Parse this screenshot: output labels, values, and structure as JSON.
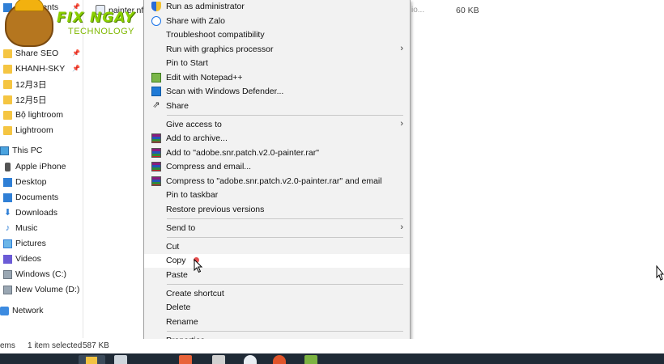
{
  "nav": {
    "items": [
      {
        "label": "Documents",
        "icon": "documents-icon",
        "pinned": true
      },
      {
        "label": "Share SEO",
        "icon": "folder-icon",
        "pinned": true
      },
      {
        "label": "KHANH-SKY",
        "icon": "folder-icon",
        "pinned": true
      },
      {
        "label": "12月3日",
        "icon": "folder-icon",
        "pinned": false
      },
      {
        "label": "12月5日",
        "icon": "folder-icon",
        "pinned": false
      },
      {
        "label": "Bộ lightroom",
        "icon": "folder-icon",
        "pinned": false
      },
      {
        "label": "Lightroom",
        "icon": "folder-icon",
        "pinned": false
      },
      {
        "label": "This PC",
        "icon": "computer-icon",
        "pinned": false
      },
      {
        "label": "Apple iPhone",
        "icon": "phone-icon",
        "pinned": false
      },
      {
        "label": "Desktop",
        "icon": "desktop-icon",
        "pinned": false
      },
      {
        "label": "Documents",
        "icon": "documents-icon",
        "pinned": false
      },
      {
        "label": "Downloads",
        "icon": "downloads-icon",
        "pinned": false
      },
      {
        "label": "Music",
        "icon": "music-icon",
        "pinned": false
      },
      {
        "label": "Pictures",
        "icon": "pictures-icon",
        "pinned": false
      },
      {
        "label": "Videos",
        "icon": "videos-icon",
        "pinned": false
      },
      {
        "label": "Windows (C:)",
        "icon": "drive-icon",
        "pinned": false
      },
      {
        "label": "New Volume (D:)",
        "icon": "drive-icon",
        "pinned": false
      },
      {
        "label": "Network",
        "icon": "network-icon",
        "pinned": false
      }
    ]
  },
  "logo": {
    "brand": "FIX NGAY",
    "sub": "TECHNOLOGY"
  },
  "file_row": {
    "name": "painter.nfo",
    "type": "io...",
    "size": "60 KB"
  },
  "status": {
    "items_label": "ems",
    "selected": "1 item selected",
    "size": "587 KB"
  },
  "menu": {
    "items": [
      {
        "label": "Run as administrator",
        "icon": "shield-icon"
      },
      {
        "label": "Share with Zalo",
        "icon": "zalo-icon"
      },
      {
        "label": "Troubleshoot compatibility",
        "icon": ""
      },
      {
        "label": "Run with graphics processor",
        "icon": "",
        "submenu": true
      },
      {
        "label": "Pin to Start",
        "icon": ""
      },
      {
        "label": "Edit with Notepad++",
        "icon": "notepad-plus-plus-icon"
      },
      {
        "label": "Scan with Windows Defender...",
        "icon": "windows-defender-icon"
      },
      {
        "label": "Share",
        "icon": "share-icon"
      },
      {
        "label": "Give access to",
        "icon": "",
        "submenu": true
      },
      {
        "label": "Add to archive...",
        "icon": "winrar-icon"
      },
      {
        "label": "Add to \"adobe.snr.patch.v2.0-painter.rar\"",
        "icon": "winrar-icon"
      },
      {
        "label": "Compress and email...",
        "icon": "winrar-icon"
      },
      {
        "label": "Compress to \"adobe.snr.patch.v2.0-painter.rar\" and email",
        "icon": "winrar-icon"
      },
      {
        "label": "Pin to taskbar",
        "icon": ""
      },
      {
        "label": "Restore previous versions",
        "icon": ""
      },
      {
        "label": "Send to",
        "icon": "",
        "submenu": true
      },
      {
        "label": "Cut",
        "icon": ""
      },
      {
        "label": "Copy",
        "icon": "",
        "hovered": true
      },
      {
        "label": "Paste",
        "icon": ""
      },
      {
        "label": "Create shortcut",
        "icon": ""
      },
      {
        "label": "Delete",
        "icon": ""
      },
      {
        "label": "Rename",
        "icon": ""
      },
      {
        "label": "Properties",
        "icon": ""
      }
    ],
    "submenu_arrow": "›"
  },
  "colors": {
    "menu_bg": "#f2f2f2",
    "hover_bg": "#ffffff",
    "taskbar": "#1f2a36",
    "click_indicator": "#e03030"
  }
}
